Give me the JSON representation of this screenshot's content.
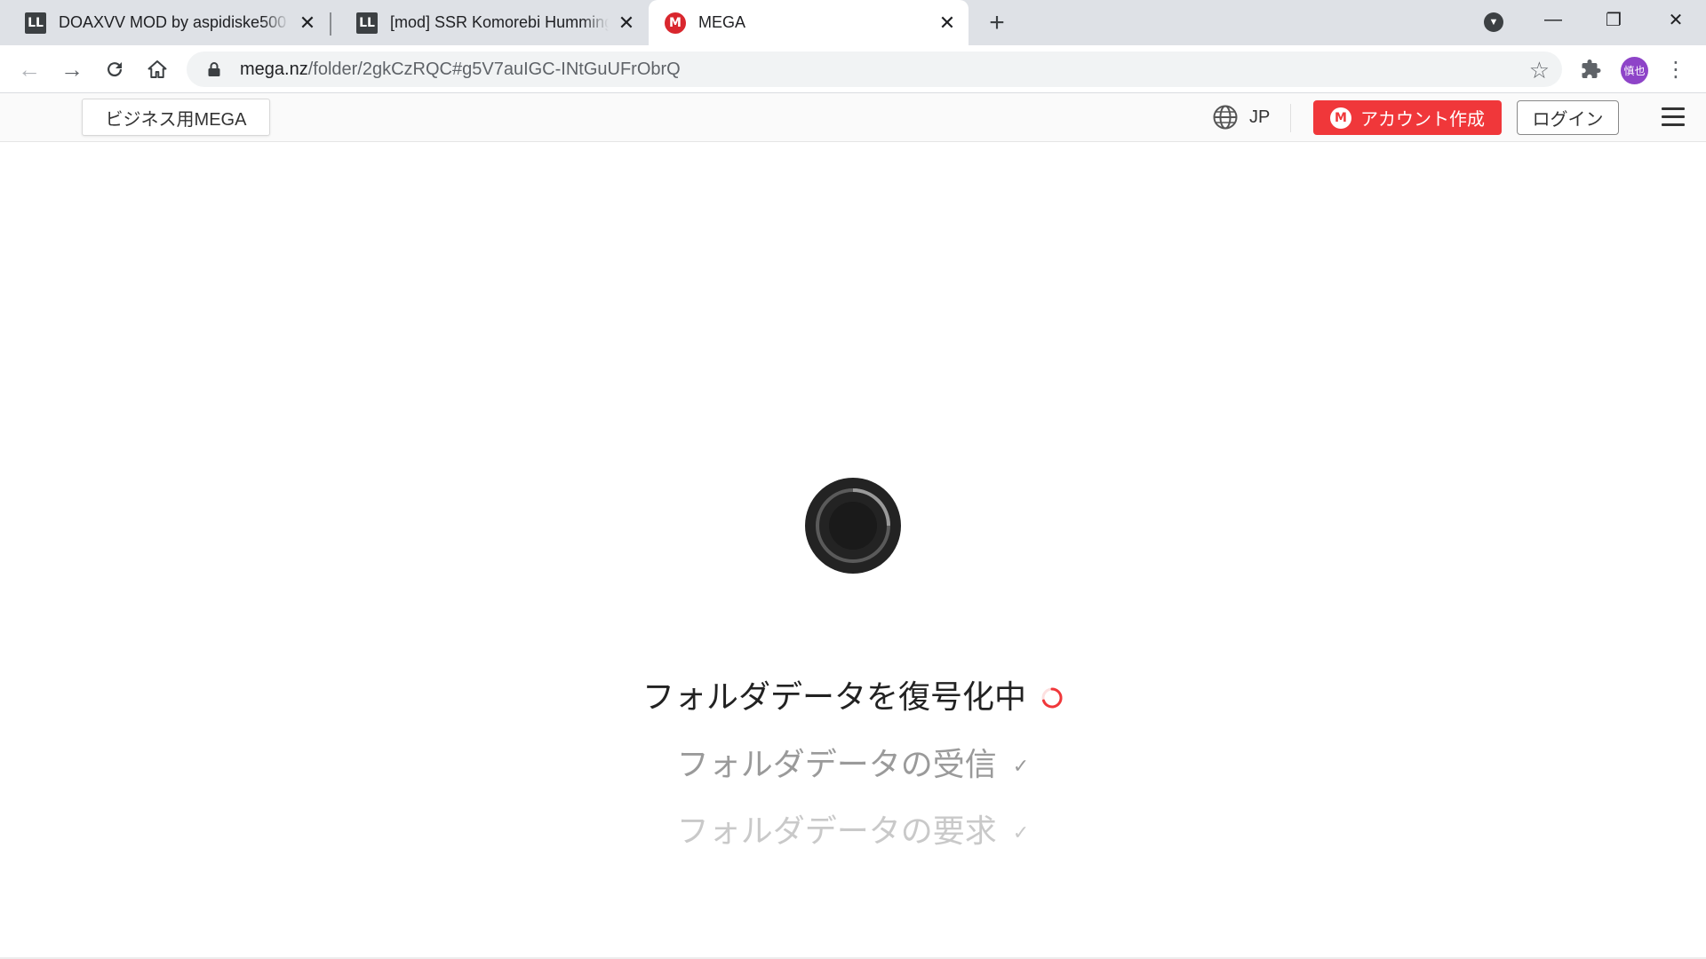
{
  "browser": {
    "tabs": [
      {
        "title": "DOAXVV MOD by aspidiske500 - ",
        "favicon": "LL",
        "active": false
      },
      {
        "title": "[mod] SSR Komorebi Humming - ",
        "favicon": "LL",
        "active": false
      },
      {
        "title": "MEGA",
        "favicon": "M",
        "active": true
      }
    ],
    "new_tab_label": "+",
    "window_controls": {
      "minimize": "—",
      "restore": "❐",
      "close": "✕"
    },
    "url_host": "mega.nz",
    "url_path": "/folder/2gkCzRQC#g5V7auIGC-INtGuUFrObrQ",
    "profile_initials": "慎也"
  },
  "header": {
    "business_label": "ビジネス用MEGA",
    "language": "JP",
    "create_account_label": "アカウント作成",
    "login_label": "ログイン"
  },
  "loading": {
    "steps": [
      {
        "label": "フォルダデータを復号化中",
        "status": "in-progress"
      },
      {
        "label": "フォルダデータの受信",
        "status": "done",
        "check": "✓"
      },
      {
        "label": "フォルダデータの要求",
        "status": "done",
        "check": "✓"
      }
    ]
  },
  "colors": {
    "mega_red": "#f0373a",
    "tabstrip_bg": "#dee1e6",
    "avatar_bg": "#8e44c8"
  }
}
